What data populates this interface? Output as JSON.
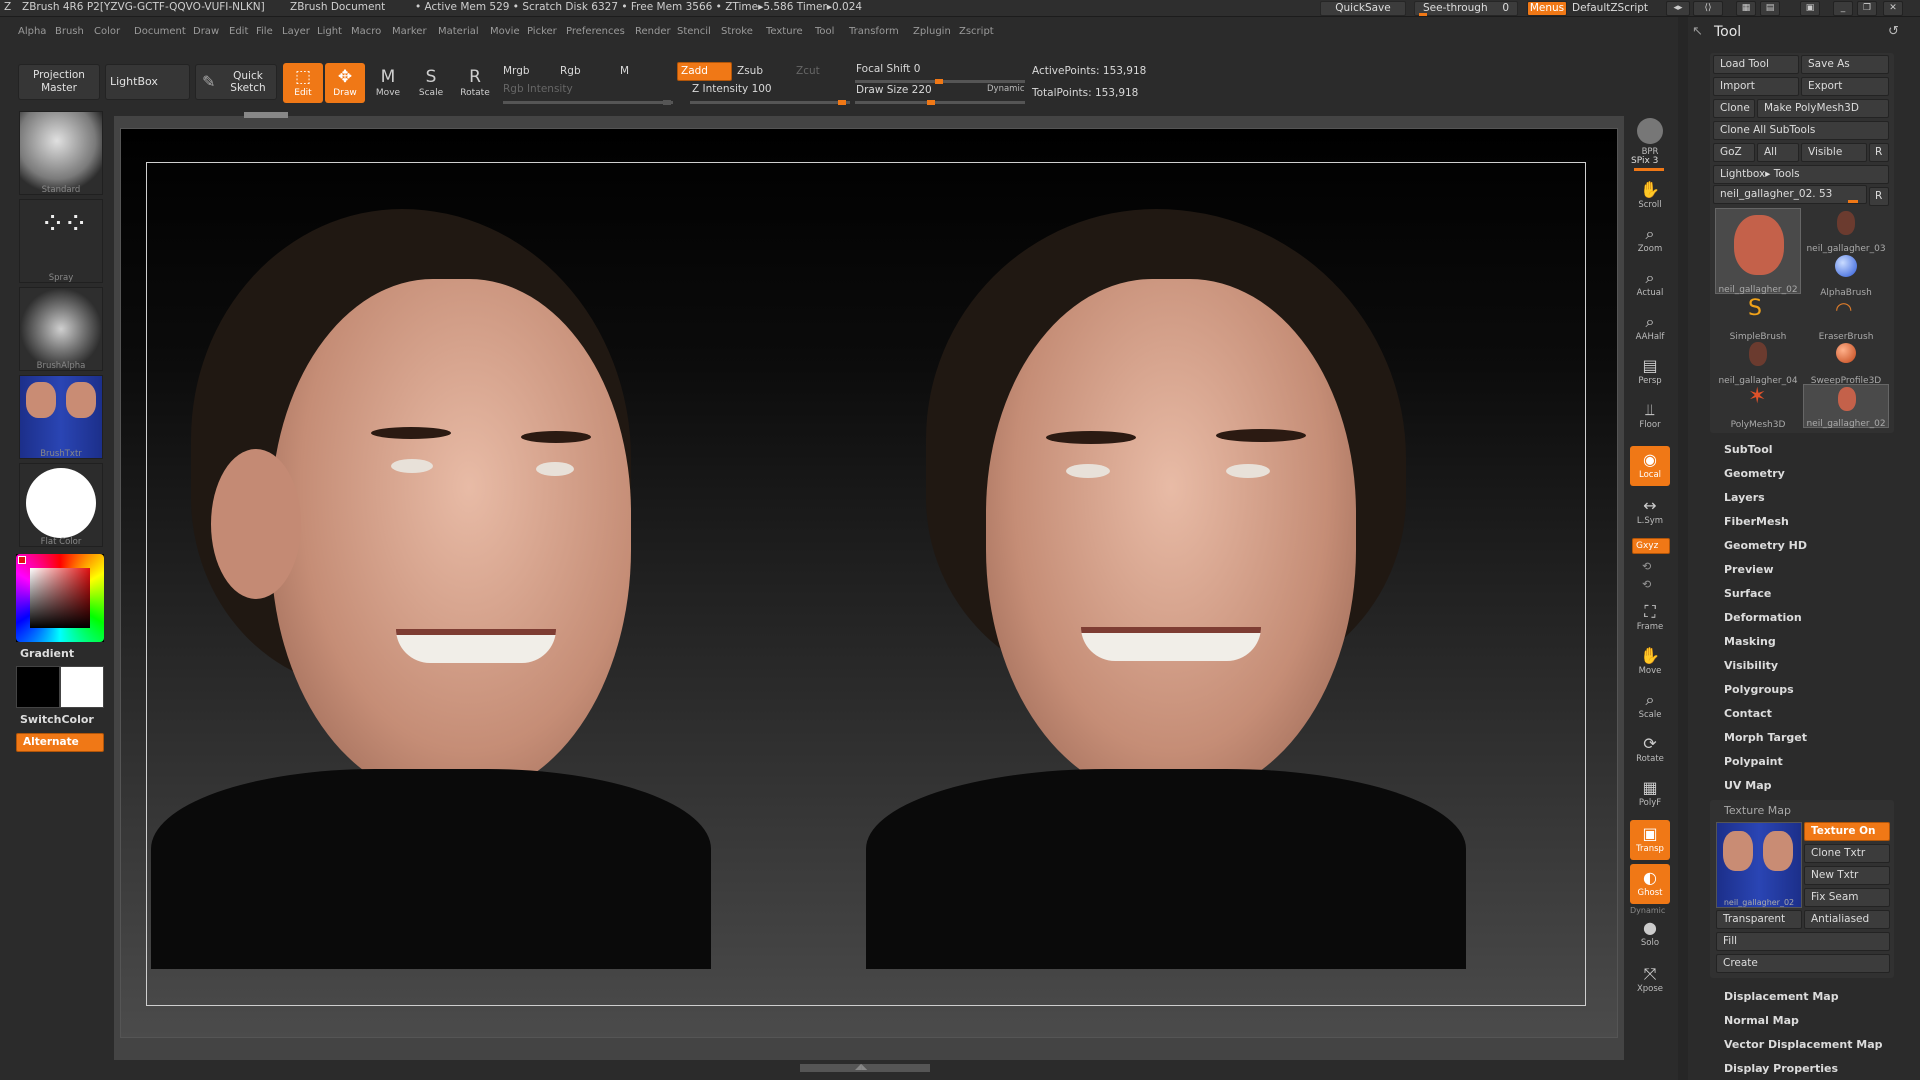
{
  "titlebar": {
    "app": "ZBrush 4R6 P2[YZVG-GCTF-QQVO-VUFI-NLKN]",
    "doc": "ZBrush Document",
    "stats": "• Active Mem 529 • Scratch Disk 6327 • Free Mem 3566 • ZTime▸5.586 Timer▸0.024",
    "quicksave": "QuickSave",
    "seethrough": "See-through",
    "seethrough_value": "0",
    "menus": "Menus",
    "script": "DefaultZScript"
  },
  "menus": [
    "Alpha",
    "Brush",
    "Color",
    "Document",
    "Draw",
    "Edit",
    "File",
    "Layer",
    "Light",
    "Macro",
    "Marker",
    "Material",
    "Movie",
    "Picker",
    "Preferences",
    "Render",
    "Stencil",
    "Stroke",
    "Texture",
    "Tool",
    "Transform",
    "Zplugin",
    "Zscript"
  ],
  "toolbar": {
    "projection_master": "Projection Master",
    "lightbox": "LightBox",
    "quick_sketch": "Quick Sketch",
    "edit": "Edit",
    "draw": "Draw",
    "move": "Move",
    "scale": "Scale",
    "rotate": "Rotate",
    "mrgb": "Mrgb",
    "rgb": "Rgb",
    "m": "M",
    "rgb_intensity": "Rgb Intensity",
    "zadd": "Zadd",
    "zsub": "Zsub",
    "zcut": "Zcut",
    "z_intensity": "Z Intensity 100",
    "focal_shift": "Focal Shift 0",
    "draw_size": "Draw Size 220",
    "dynamic": "Dynamic",
    "active_points": "ActivePoints: 153,918",
    "total_points": "TotalPoints: 153,918"
  },
  "leftshelf": {
    "standard": "Standard",
    "spray": "Spray",
    "brushalpha": "BrushAlpha",
    "brushtxtr": "BrushTxtr",
    "flat_color": "Flat Color",
    "gradient": "Gradient",
    "switchcolor": "SwitchColor",
    "alternate": "Alternate",
    "colors": {
      "accent": "#f07816"
    }
  },
  "rightshelf": {
    "bpr": "BPR",
    "spix": "SPix 3",
    "scroll": "Scroll",
    "zoom": "Zoom",
    "actual": "Actual",
    "aahalf": "AAHalf",
    "persp": "Persp",
    "floor": "Floor",
    "local": "Local",
    "lsym": "L.Sym",
    "xyz": "Gxyz",
    "frame": "Frame",
    "move": "Move",
    "scale": "Scale",
    "rotate": "Rotate",
    "polyf": "PolyF",
    "transp": "Transp",
    "ghost": "Ghost",
    "dynamic": "Dynamic",
    "solo": "Solo",
    "xpose": "Xpose"
  },
  "tool": {
    "title": "Tool",
    "load_tool": "Load Tool",
    "save_as": "Save As",
    "import": "Import",
    "export": "Export",
    "clone": "Clone",
    "make_polymesh": "Make PolyMesh3D",
    "clone_all": "Clone All SubTools",
    "goz": "GoZ",
    "all": "All",
    "visible": "Visible",
    "r": "R",
    "lightbox_tools": "Lightbox▸ Tools",
    "current_tool": "neil_gallagher_02. 53",
    "current_r": "R",
    "thumbs": [
      "neil_gallagher_02",
      "neil_gallagher_03",
      "AlphaBrush",
      "SimpleBrush",
      "EraserBrush",
      "neil_gallagher_04",
      "SweepProfile3D",
      "PolyMesh3D",
      "neil_gallagher_02"
    ],
    "sections": [
      "SubTool",
      "Geometry",
      "Layers",
      "FiberMesh",
      "Geometry HD",
      "Preview",
      "Surface",
      "Deformation",
      "Masking",
      "Visibility",
      "Polygroups",
      "Contact",
      "Morph Target",
      "Polypaint",
      "UV Map"
    ],
    "texture_map": {
      "title": "Texture Map",
      "thumb_caption": "neil_gallagher_02",
      "texture_on": "Texture On",
      "clone_txtr": "Clone Txtr",
      "new_txtr": "New Txtr",
      "fix_seam": "Fix Seam",
      "transparent": "Transparent",
      "antialiased": "Antialiased",
      "fill": "Fill",
      "create": "Create"
    },
    "sections_after": [
      "Displacement Map",
      "Normal Map",
      "Vector Displacement Map",
      "Display Properties"
    ]
  }
}
